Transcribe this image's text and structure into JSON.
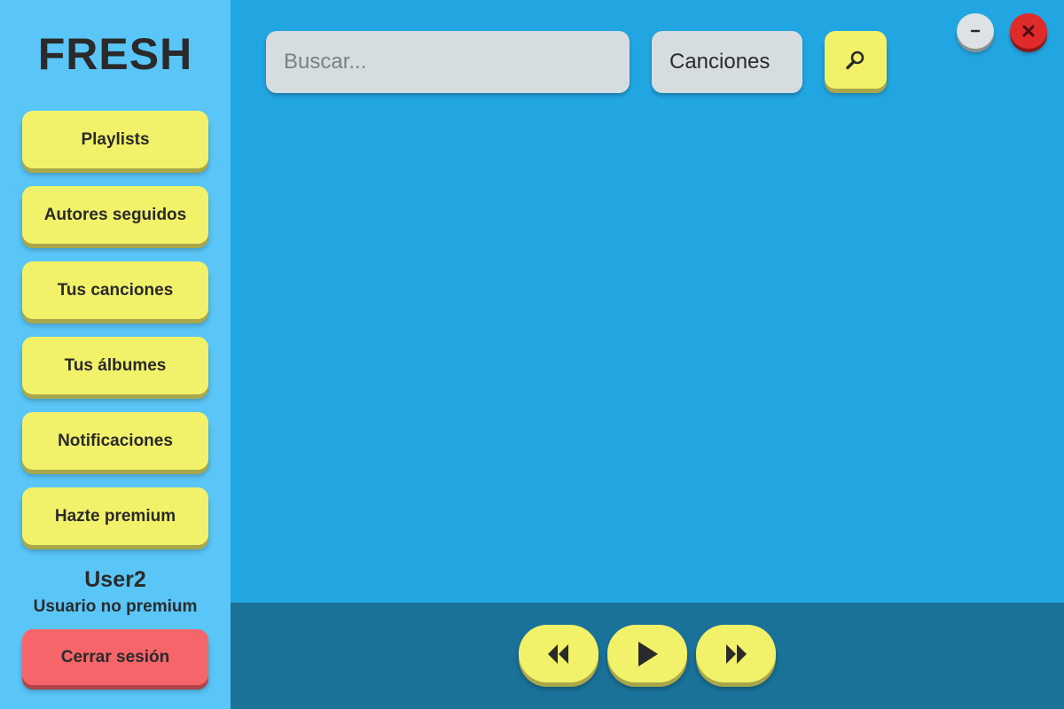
{
  "app": {
    "title": "FRESH"
  },
  "sidebar": {
    "items": [
      {
        "label": "Playlists"
      },
      {
        "label": "Autores seguidos"
      },
      {
        "label": "Tus canciones"
      },
      {
        "label": "Tus álbumes"
      },
      {
        "label": "Notificaciones"
      },
      {
        "label": "Hazte premium"
      }
    ],
    "user": {
      "name": "User2",
      "status": "Usuario no premium"
    },
    "logout_label": "Cerrar sesión"
  },
  "search": {
    "placeholder": "Buscar...",
    "value": "",
    "type_selected": "Canciones",
    "button_icon": "search-icon"
  },
  "window": {
    "minimize_icon": "minimize-icon",
    "close_icon": "close-icon"
  },
  "player": {
    "prev_icon": "rewind-icon",
    "play_icon": "play-icon",
    "next_icon": "fast-forward-icon"
  },
  "colors": {
    "sidebar_bg": "#59c6f7",
    "main_bg": "#22a6e2",
    "player_bg": "#1a7299",
    "button_yellow": "#f2f26a",
    "logout_red": "#f6656a",
    "close_red": "#e02b2b",
    "input_gray": "#d6dde0"
  }
}
